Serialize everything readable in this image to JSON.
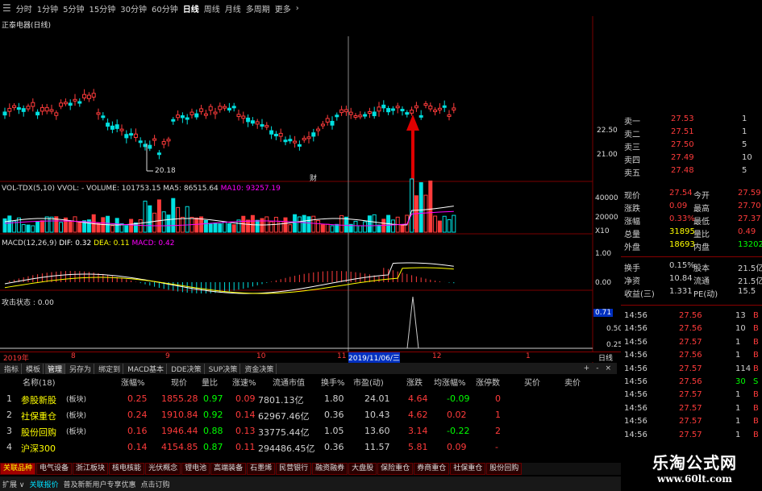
{
  "periods": {
    "items": [
      "分时",
      "1分钟",
      "5分钟",
      "15分钟",
      "30分钟",
      "60分钟",
      "日线",
      "周线",
      "月线",
      "多周期",
      "更多"
    ],
    "more_icon": "›"
  },
  "main_chart": {
    "title": "正泰电器(日线)",
    "price_labels": [
      "22.50",
      "21.00"
    ],
    "low_label": "20.18",
    "marker": "财"
  },
  "volume": {
    "header_name": "VOL-TDX(5,10)",
    "header_vol": "VVOL: -",
    "header_volume": "VOLUME: 101753.15",
    "header_ma5": "MA5: 86515.64",
    "header_ma10": "MA10: 93257.19",
    "axis": [
      "40000",
      "20000",
      "X10"
    ]
  },
  "macd": {
    "header_name": "MACD(12,26,9)",
    "header_dif": "DIF: 0.32",
    "header_dea": "DEA: 0.11",
    "header_macd": "MACD: 0.42",
    "axis": [
      "1.00",
      "0.00"
    ]
  },
  "attack": {
    "header": "攻击状态 : 0.00",
    "axis": [
      "0.71",
      "0.50",
      "0.25"
    ]
  },
  "date_axis": {
    "labels": [
      "2019年",
      "8",
      "9",
      "10",
      "11",
      "12",
      "1"
    ],
    "highlight": "2019/11/06/三",
    "period": "日线"
  },
  "tabs": {
    "items": [
      "指标",
      "模板",
      "管理",
      "另存为",
      "绑定到",
      "MACD基本",
      "DDE决策",
      "SUP决策",
      "资金决策"
    ],
    "controls": [
      "+",
      "-",
      "×"
    ]
  },
  "quote": {
    "asks": [
      {
        "label": "卖一",
        "price": "27.53",
        "vol": "1"
      },
      {
        "label": "卖二",
        "price": "27.51",
        "vol": "1"
      },
      {
        "label": "卖三",
        "price": "27.50",
        "vol": "5"
      },
      {
        "label": "卖四",
        "price": "27.49",
        "vol": "10"
      },
      {
        "label": "卖五",
        "price": "27.48",
        "vol": "5"
      }
    ],
    "stats": [
      {
        "l1": "现价",
        "v1": "27.54",
        "l2": "今开",
        "v2": "27.59"
      },
      {
        "l1": "涨跌",
        "v1": "0.09",
        "l2": "最高",
        "v2": "27.70"
      },
      {
        "l1": "涨幅",
        "v1": "0.33%",
        "l2": "最低",
        "v2": "27.37"
      },
      {
        "l1": "总量",
        "v1": "31895",
        "l2": "量比",
        "v2": "0.49"
      },
      {
        "l1": "外盘",
        "v1": "18693",
        "l2": "内盘",
        "v2": "13202"
      }
    ],
    "stats2": [
      {
        "l1": "换手",
        "v1": "0.15%",
        "l2": "股本",
        "v2": "21.5亿"
      },
      {
        "l1": "净资",
        "v1": "10.84",
        "l2": "流通",
        "v2": "21.5亿"
      },
      {
        "l1": "收益(三)",
        "v1": "1.331",
        "l2": "PE(动)",
        "v2": "15.5"
      }
    ],
    "ticks": [
      {
        "t": "14:56",
        "p": "27.56",
        "v": "13",
        "d": "B"
      },
      {
        "t": "14:56",
        "p": "27.56",
        "v": "10",
        "d": "B"
      },
      {
        "t": "14:56",
        "p": "27.57",
        "v": "1",
        "d": "B"
      },
      {
        "t": "14:56",
        "p": "27.56",
        "v": "1",
        "d": "B"
      },
      {
        "t": "14:56",
        "p": "27.57",
        "v": "114",
        "d": "B"
      },
      {
        "t": "14:56",
        "p": "27.56",
        "v": "30",
        "d": "S"
      },
      {
        "t": "14:56",
        "p": "27.57",
        "v": "1",
        "d": "B"
      },
      {
        "t": "14:56",
        "p": "27.57",
        "v": "1",
        "d": "B"
      },
      {
        "t": "14:56",
        "p": "27.57",
        "v": "1",
        "d": "B"
      },
      {
        "t": "14:56",
        "p": "27.57",
        "v": "1",
        "d": "B"
      }
    ]
  },
  "table": {
    "headers": [
      "名称(18)",
      "涨幅%",
      "现价",
      "量比",
      "涨速%",
      "流通市值",
      "换手%",
      "市盈(动)",
      "涨跌",
      "均涨幅%",
      "涨停数",
      "买价",
      "卖价"
    ],
    "rows": [
      {
        "idx": "1",
        "name": "参股新股",
        "tag": "(板块)",
        "chg": "0.25",
        "price": "1855.28",
        "vr": "0.97",
        "spd": "0.09",
        "cap": "7801.13亿",
        "turn": "1.80",
        "pe": "24.01",
        "up": "4.64",
        "avg": "-0.09",
        "lim": "0"
      },
      {
        "idx": "2",
        "name": "社保重仓",
        "tag": "(板块)",
        "chg": "0.24",
        "price": "1910.84",
        "vr": "0.92",
        "spd": "0.14",
        "cap": "62967.46亿",
        "turn": "0.36",
        "pe": "10.43",
        "up": "4.62",
        "avg": "0.02",
        "lim": "1"
      },
      {
        "idx": "3",
        "name": "股份回购",
        "tag": "(板块)",
        "chg": "0.16",
        "price": "1946.44",
        "vr": "0.88",
        "spd": "0.13",
        "cap": "33775.44亿",
        "turn": "1.05",
        "pe": "13.60",
        "up": "3.14",
        "avg": "-0.22",
        "lim": "2"
      },
      {
        "idx": "4",
        "name": "沪深300",
        "tag": "",
        "chg": "0.14",
        "price": "4154.85",
        "vr": "0.87",
        "spd": "0.11",
        "cap": "294486.45亿",
        "turn": "0.36",
        "pe": "11.57",
        "up": "5.81",
        "avg": "0.09",
        "lim": "-"
      }
    ]
  },
  "bottom_tabs": [
    "关联品种",
    "电气设备",
    "浙江板块",
    "核电核能",
    "光伏概念",
    "锂电池",
    "高端装备",
    "石墨烯",
    "民营银行",
    "融资融券",
    "大盘股",
    "保险重仓",
    "券商重仓",
    "社保重仓",
    "股份回购"
  ],
  "status": {
    "expand": "扩展 ∨",
    "link": "关联报价",
    "news": "普及新新用户专享优惠",
    "order": "点击订购"
  },
  "watermark": {
    "title": "乐淘公式网",
    "url": "www.60lt.com"
  },
  "colors": {
    "up": "#ff3b3b",
    "down": "#00e0e0",
    "ma5": "#ffffff",
    "ma10": "#ff00ff",
    "dea": "#ffff00"
  }
}
